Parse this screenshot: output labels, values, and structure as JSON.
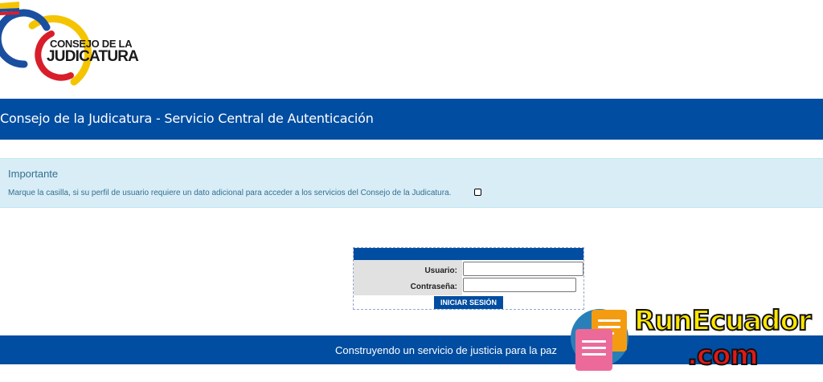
{
  "logo": {
    "line1": "CONSEJO DE LA",
    "line2": "JUDICATURA",
    "colors": {
      "yellow": "#f5c400",
      "blue": "#1a4fa0",
      "red": "#d81e2a"
    }
  },
  "header": {
    "title": "Consejo de la Judicatura - Servicio Central de Autenticación"
  },
  "notice": {
    "title": "Importante",
    "text": "Marque la casilla, si su perfil de usuario requiere un dato adicional para acceder a los servicios del Consejo de la Judicatura.",
    "checkbox_checked": false
  },
  "login": {
    "user_label": "Usuario:",
    "user_value": "",
    "pass_label": "Contraseña:",
    "pass_value": "",
    "submit_label": "INICIAR SESIÓN"
  },
  "footer": {
    "text": "Construyendo un servicio de justicia para la paz"
  },
  "watermark": {
    "line1": "RunEcuador",
    "line2": ".com"
  },
  "colors": {
    "primary": "#014da1",
    "notice_bg": "#d9edf7",
    "notice_text": "#31708f"
  }
}
